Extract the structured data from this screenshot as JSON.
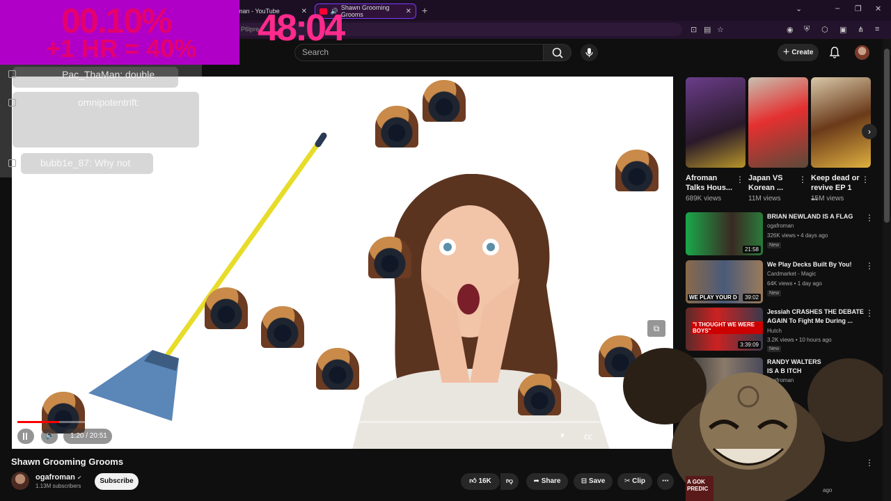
{
  "browser": {
    "tabs": [
      {
        "label": "man - YouTube"
      },
      {
        "label": "Shawn Grooming Grooms"
      }
    ],
    "address_fragment": "P6lpre"
  },
  "header": {
    "search_placeholder": "Search",
    "create_label": "Create"
  },
  "overlay": {
    "percent": "00.10%",
    "bonus": "+1 HR = 40%",
    "countdown": "48:04"
  },
  "chat": [
    {
      "user": "Pac_ThaMan",
      "text": ": double"
    },
    {
      "user": "omnipotentrift",
      "text": ":"
    },
    {
      "user": "bubb1e_87",
      "text": ": Why not"
    }
  ],
  "player": {
    "current_time": "1:20",
    "duration": "20:51",
    "time_display": "1:20 / 20:51",
    "progress": 0.064
  },
  "video": {
    "title": "Shawn Grooming Grooms",
    "channel": "ogafroman",
    "subscribers": "1.13M subscribers",
    "subscribe_label": "Subscribe",
    "likes": "16K",
    "share_label": "Share",
    "save_label": "Save",
    "clip_label": "Clip"
  },
  "shorts": [
    {
      "title": "Afroman Talks Hous...",
      "views": "689K views"
    },
    {
      "title": "Japan VS Korean ...",
      "views": "11M views"
    },
    {
      "title": "Keep dead or revive EP 1 ...",
      "views": "15M views"
    }
  ],
  "recommendations": [
    {
      "title": "BRIAN NEWLAND IS A FLAG",
      "channel": "ogafroman",
      "meta": "326K views • 4 days ago",
      "badge": "New",
      "duration": "21:58"
    },
    {
      "title": "We Play Decks Built By You!",
      "channel": "Cardmarket - Magic",
      "meta": "64K views • 1 day ago",
      "badge": "New",
      "duration": "39:02",
      "thumb_text": "WE PLAY YOUR D"
    },
    {
      "title": "Jessiah CRASHES THE DEBATE AGAIN To Fight Me During ...",
      "channel": "Hutch",
      "meta": "3.2K views • 10 hours ago",
      "badge": "New",
      "duration": "3:39:09",
      "thumb_text": "\"I THOUGHT WE WERE BOYS\""
    },
    {
      "title": "RANDY WALTERS IS A B ITCH",
      "channel": "ogafroman",
      "meta": "",
      "badge": "",
      "duration": ""
    }
  ],
  "bottom_right": {
    "thumb_text": "A GOK PREDIC",
    "meta": "ago"
  }
}
